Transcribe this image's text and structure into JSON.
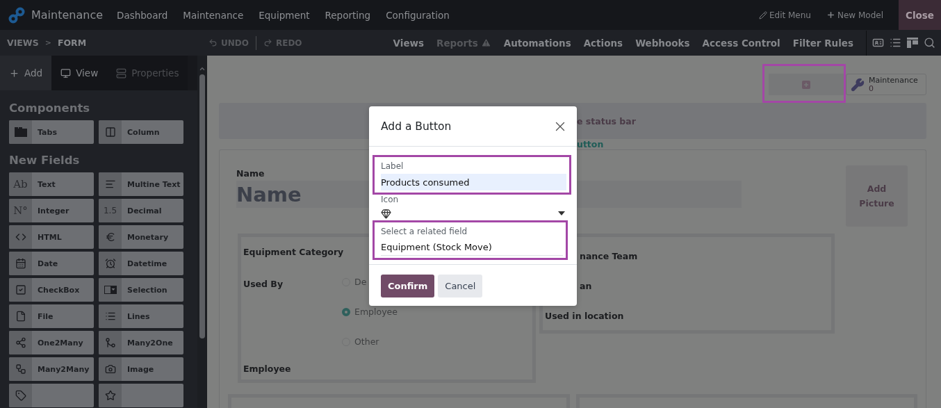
{
  "top_nav": {
    "app_name": "Maintenance",
    "menu": [
      "Dashboard",
      "Maintenance",
      "Equipment",
      "Reporting",
      "Configuration"
    ],
    "actions": [
      {
        "label": "Edit Menu",
        "kind": "edit"
      },
      {
        "label": "New Model",
        "kind": "new"
      }
    ],
    "close": "Close"
  },
  "toolbar": {
    "breadcrumb": [
      "VIEWS",
      "FORM"
    ],
    "separator": ">",
    "undo": {
      "label": "UNDO",
      "disabled": true
    },
    "redo": {
      "label": "REDO",
      "disabled": true
    },
    "menu": [
      {
        "label": "Views",
        "disabled": false,
        "warning": false
      },
      {
        "label": "Reports",
        "disabled": true,
        "warning": true
      },
      {
        "label": "Automations",
        "disabled": false,
        "warning": false
      },
      {
        "label": "Actions",
        "disabled": false,
        "warning": false
      },
      {
        "label": "Webhooks",
        "disabled": false,
        "warning": false
      },
      {
        "label": "Access Control",
        "disabled": false,
        "warning": false
      },
      {
        "label": "Filter Rules",
        "disabled": false,
        "warning": false
      }
    ]
  },
  "sidebar": {
    "tabs": [
      {
        "label": "Add",
        "kind": "add",
        "selected": true,
        "disabled": false
      },
      {
        "label": "View",
        "kind": "view",
        "selected": false,
        "disabled": false
      },
      {
        "label": "Properties",
        "kind": "properties",
        "selected": false,
        "disabled": true
      }
    ],
    "sections": [
      {
        "title": "Components",
        "items": [
          {
            "label": "Tabs",
            "kind": "tabs"
          },
          {
            "label": "Column",
            "kind": "column"
          }
        ]
      },
      {
        "title": "New Fields",
        "items": [
          {
            "label": "Text",
            "kind": "glyph",
            "glyph": "Ab"
          },
          {
            "label": "Multine Text",
            "kind": "multiline"
          },
          {
            "label": "Integer",
            "kind": "glyph",
            "glyph": "N°"
          },
          {
            "label": "Decimal",
            "kind": "glyph",
            "glyph": "1.5"
          },
          {
            "label": "HTML",
            "kind": "html"
          },
          {
            "label": "Monetary",
            "kind": "monetary"
          },
          {
            "label": "Date",
            "kind": "date"
          },
          {
            "label": "Datetime",
            "kind": "datetime"
          },
          {
            "label": "CheckBox",
            "kind": "checkbox"
          },
          {
            "label": "Selection",
            "kind": "selection"
          },
          {
            "label": "File",
            "kind": "file"
          },
          {
            "label": "Lines",
            "kind": "lines"
          },
          {
            "label": "One2Many",
            "kind": "one2many"
          },
          {
            "label": "Many2One",
            "kind": "many2one"
          },
          {
            "label": "Many2Many",
            "kind": "many2many"
          },
          {
            "label": "Image",
            "kind": "image"
          },
          {
            "kind": "tag"
          },
          {
            "kind": "star"
          }
        ]
      }
    ]
  },
  "form": {
    "add_button": {
      "highlighted": true
    },
    "stat_buttons": [
      {
        "label": "Maintenance",
        "value": "0"
      }
    ],
    "status_bar": "e status bar",
    "add_link": "utton",
    "name_label": "Name",
    "name_placeholder": "Name",
    "picture_button": "Add Picture",
    "left_group": [
      {
        "label": "Equipment Category",
        "kind": "plain"
      },
      {
        "label": "Used By",
        "kind": "radio",
        "options": [
          {
            "label": "De",
            "selected": false
          },
          {
            "label": "Employee",
            "selected": true
          },
          {
            "label": "Other",
            "selected": false
          }
        ]
      },
      {
        "label": "Employee",
        "kind": "plain"
      }
    ],
    "right_group": [
      {
        "label": "nance Team"
      },
      {
        "label": "an"
      },
      {
        "label": "Used in location"
      }
    ]
  },
  "dialog": {
    "title": "Add a Button",
    "label_field": {
      "label": "Label",
      "value": "Products consumed",
      "highlighted": true
    },
    "icon_field": {
      "label": "Icon"
    },
    "related_field": {
      "label": "Select a related field",
      "value": "Equipment (Stock Move)",
      "highlighted": true
    },
    "buttons": [
      {
        "label": "Confirm",
        "kind": "primary"
      },
      {
        "label": "Cancel",
        "kind": "secondary"
      }
    ]
  }
}
